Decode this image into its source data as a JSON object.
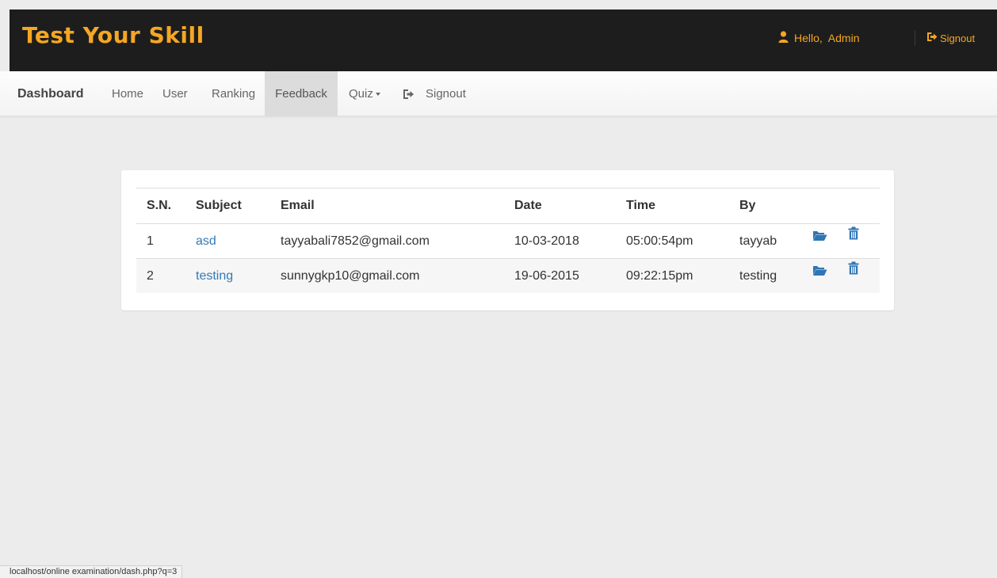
{
  "header": {
    "brand": "Test Your Skill",
    "greeting": "Hello,  Admin",
    "signout_label": "Signout"
  },
  "nav": {
    "brand": "Dashboard",
    "items": [
      {
        "label": "Home"
      },
      {
        "label": "User"
      },
      {
        "label": "Ranking"
      },
      {
        "label": "Feedback",
        "active": true
      },
      {
        "label": "Quiz"
      },
      {
        "label": "Signout"
      }
    ]
  },
  "table": {
    "columns": [
      "S.N.",
      "Subject",
      "Email",
      "Date",
      "Time",
      "By"
    ],
    "rows": [
      {
        "sn": "1",
        "subject": "asd",
        "email": "tayyabali7852@gmail.com",
        "date": "10-03-2018",
        "time": "05:00:54pm",
        "by": "tayyab"
      },
      {
        "sn": "2",
        "subject": "testing",
        "email": "sunnygkp10@gmail.com",
        "date": "19-06-2015",
        "time": "09:22:15pm",
        "by": "testing"
      }
    ],
    "actions": {
      "open_icon": "folder-open-icon",
      "delete_icon": "trash-icon"
    }
  },
  "statusbar": {
    "url": "localhost/online examination/dash.php?q=3"
  },
  "colors": {
    "brand": "#f5a623",
    "link": "#337ab7",
    "topbar_bg": "#1d1d1d",
    "page_bg": "#ececec"
  }
}
